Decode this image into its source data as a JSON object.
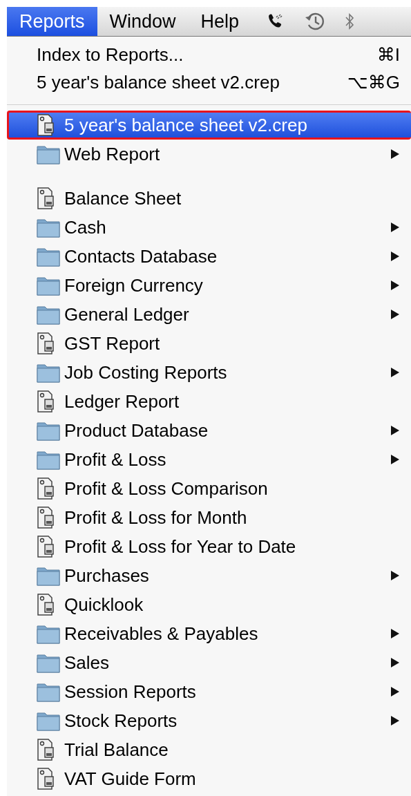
{
  "menu_bar": {
    "menus": [
      {
        "label": "Reports",
        "selected": true
      },
      {
        "label": "Window",
        "selected": false
      },
      {
        "label": "Help",
        "selected": false
      }
    ]
  },
  "menu": {
    "commands": [
      {
        "label": "Index to Reports...",
        "shortcut": "⌘I"
      },
      {
        "label": "5 year's balance sheet v2.crep",
        "shortcut": "⌥⌘G"
      }
    ],
    "recent": [
      {
        "kind": "report",
        "label": "5 year's balance sheet v2.crep",
        "selected": true,
        "has_submenu": false
      },
      {
        "kind": "folder",
        "label": "Web Report",
        "selected": false,
        "has_submenu": true
      }
    ],
    "reports": [
      {
        "kind": "report",
        "label": "Balance Sheet",
        "selected": false,
        "has_submenu": false
      },
      {
        "kind": "folder",
        "label": "Cash",
        "selected": false,
        "has_submenu": true
      },
      {
        "kind": "folder",
        "label": "Contacts Database",
        "selected": false,
        "has_submenu": true
      },
      {
        "kind": "folder",
        "label": "Foreign Currency",
        "selected": false,
        "has_submenu": true
      },
      {
        "kind": "folder",
        "label": "General Ledger",
        "selected": false,
        "has_submenu": true
      },
      {
        "kind": "report",
        "label": "GST Report",
        "selected": false,
        "has_submenu": false
      },
      {
        "kind": "folder",
        "label": "Job Costing Reports",
        "selected": false,
        "has_submenu": true
      },
      {
        "kind": "report",
        "label": "Ledger Report",
        "selected": false,
        "has_submenu": false
      },
      {
        "kind": "folder",
        "label": "Product Database",
        "selected": false,
        "has_submenu": true
      },
      {
        "kind": "folder",
        "label": "Profit & Loss",
        "selected": false,
        "has_submenu": true
      },
      {
        "kind": "report",
        "label": "Profit & Loss Comparison",
        "selected": false,
        "has_submenu": false
      },
      {
        "kind": "report",
        "label": "Profit & Loss for Month",
        "selected": false,
        "has_submenu": false
      },
      {
        "kind": "report",
        "label": "Profit & Loss for Year to Date",
        "selected": false,
        "has_submenu": false
      },
      {
        "kind": "folder",
        "label": "Purchases",
        "selected": false,
        "has_submenu": true
      },
      {
        "kind": "report",
        "label": "Quicklook",
        "selected": false,
        "has_submenu": false
      },
      {
        "kind": "folder",
        "label": "Receivables & Payables",
        "selected": false,
        "has_submenu": true
      },
      {
        "kind": "folder",
        "label": "Sales",
        "selected": false,
        "has_submenu": true
      },
      {
        "kind": "folder",
        "label": "Session Reports",
        "selected": false,
        "has_submenu": true
      },
      {
        "kind": "folder",
        "label": "Stock Reports",
        "selected": false,
        "has_submenu": true
      },
      {
        "kind": "report",
        "label": "Trial Balance",
        "selected": false,
        "has_submenu": false
      },
      {
        "kind": "report",
        "label": "VAT Guide Form",
        "selected": false,
        "has_submenu": false
      }
    ]
  }
}
